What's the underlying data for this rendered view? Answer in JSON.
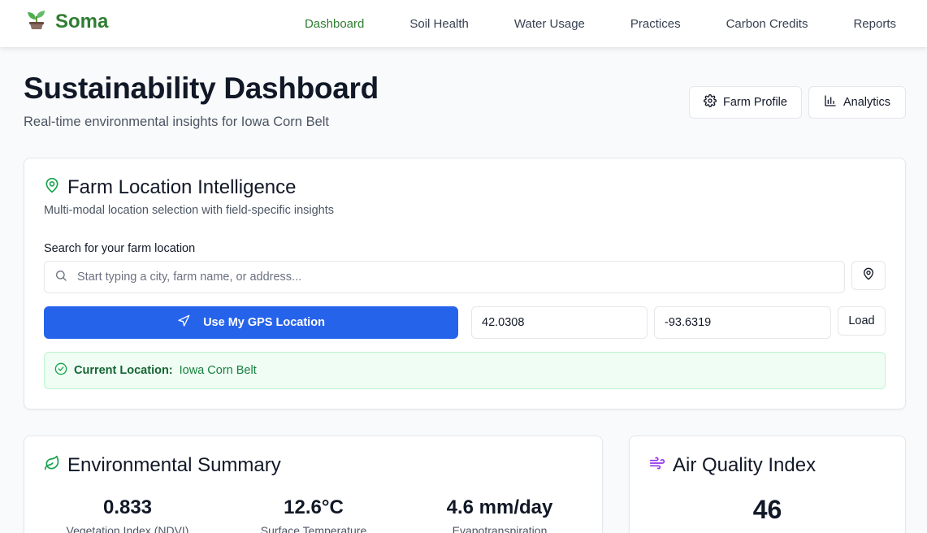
{
  "app": {
    "name": "Soma"
  },
  "nav": {
    "items": [
      {
        "label": "Dashboard",
        "active": true
      },
      {
        "label": "Soil Health"
      },
      {
        "label": "Water Usage"
      },
      {
        "label": "Practices"
      },
      {
        "label": "Carbon Credits"
      },
      {
        "label": "Reports"
      }
    ]
  },
  "header": {
    "title": "Sustainability Dashboard",
    "subtitle": "Real-time environmental insights for Iowa Corn Belt",
    "farm_profile_label": "Farm Profile",
    "analytics_label": "Analytics"
  },
  "location": {
    "title": "Farm Location Intelligence",
    "description": "Multi-modal location selection with field-specific insights",
    "search_label": "Search for your farm location",
    "search_placeholder": "Start typing a city, farm name, or address...",
    "search_value": "",
    "gps_label": "Use My GPS Location",
    "latitude": "42.0308",
    "longitude": "-93.6319",
    "load_label": "Load",
    "status_label": "Current Location:",
    "status_value": "Iowa Corn Belt"
  },
  "environment": {
    "title": "Environmental Summary",
    "metrics": [
      {
        "value": "0.833",
        "label": "Vegetation Index (NDVI)"
      },
      {
        "value": "12.6°C",
        "label": "Surface Temperature"
      },
      {
        "value": "4.6 mm/day",
        "label": "Evapotranspiration"
      }
    ]
  },
  "air_quality": {
    "title": "Air Quality Index",
    "value": "46"
  },
  "colors": {
    "brand": "#2f7d32",
    "primary": "#2563eb",
    "success_bg": "#f0fdf4",
    "aqi_icon": "#9333ea"
  },
  "icons": {
    "brand": "sprout-icon",
    "farm_profile": "gear-icon",
    "analytics": "bar-chart-icon",
    "location_title": "map-pin-icon",
    "search": "search-icon",
    "pin_button": "map-pin-icon",
    "gps": "navigation-icon",
    "status": "check-circle-icon",
    "environment": "leaf-icon",
    "air_quality": "wind-icon"
  }
}
